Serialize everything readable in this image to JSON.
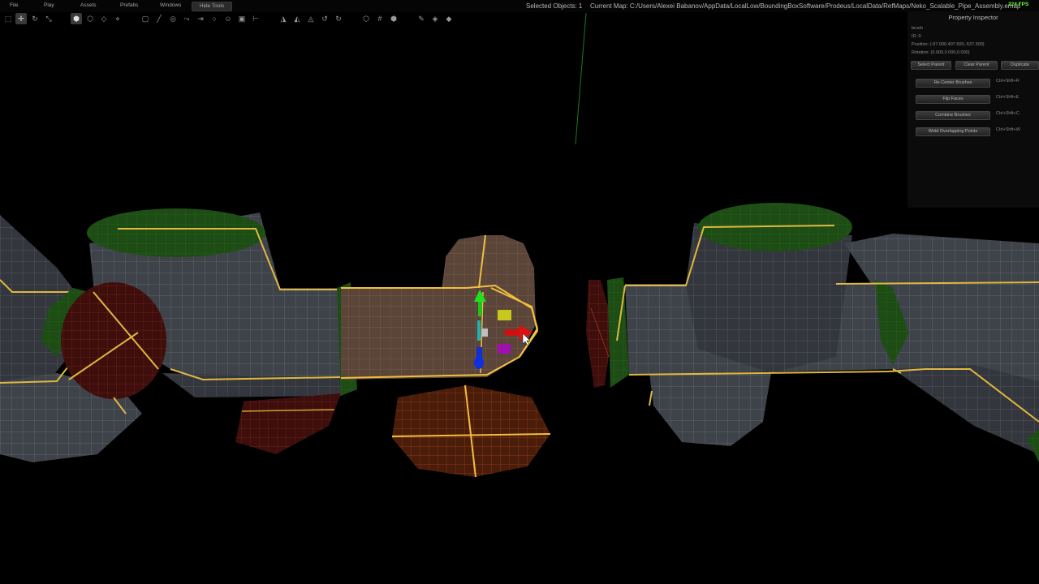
{
  "menu": {
    "file": "File",
    "play": "Play",
    "assets": "Assets",
    "prefabs": "Prefabs",
    "windows": "Windows",
    "hide_tools": "Hide Tools"
  },
  "status": {
    "selected_objects": "Selected Objects: 1",
    "current_map": "Current Map: C:/Users/Alexei Babanov/AppData/LocalLow/BoundingBoxSoftware/Prodeus/LocalData/RefMaps/Neko_Scalable_Pipe_Assembly.emap",
    "fps": "224 FPS"
  },
  "toolbar": {
    "icons": [
      "select-icon",
      "move-icon",
      "rotate-icon",
      "scale-icon",
      "solid-view-icon",
      "shaded-view-icon",
      "wireframe-icon",
      "vertex-view-icon",
      "box-tool-icon",
      "line-tool-icon",
      "cylinder-tool-icon",
      "path-tool-icon",
      "clip-tool-icon",
      "sphere-tool-icon",
      "face-tool-icon",
      "texture-tool-icon",
      "measure-icon",
      "mirror-x-icon",
      "mirror-y-icon",
      "mirror-z-icon",
      "rotate-left-icon",
      "rotate-right-icon",
      "cube-icon",
      "grid-icon",
      "snap-icon",
      "eyedropper-icon",
      "paint-bucket-icon",
      "fill-icon"
    ]
  },
  "inspector": {
    "title": "Property Inspector",
    "name": "brush",
    "id": "ID: 0",
    "position": "Position: (-97.000,407.500,-537.500)",
    "rotation": "Rotation: (0.000,0.000,0.000)",
    "select_parent": "Select Parent",
    "clear_parent": "Clear Parent",
    "duplicate": "Duplicate",
    "actions": [
      {
        "label": "Re-Center Brushes",
        "shortcut": "Ctrl+Shft+R"
      },
      {
        "label": "Flip Faces",
        "shortcut": "Ctrl+Shft+E"
      },
      {
        "label": "Combine Brushes",
        "shortcut": "Ctrl+Shft+C"
      },
      {
        "label": "Weld Overlapping Points",
        "shortcut": "Ctrl+Shft+W"
      }
    ]
  },
  "colors": {
    "background": "#000000",
    "mesh_gray": "#3e4249",
    "mesh_green": "#1d4d14",
    "selected_brown": "#5a4538",
    "edge_yellow": "#f0c040",
    "red_face": "#4a1010",
    "gizmo_red": "#e01010",
    "gizmo_green": "#20d020",
    "gizmo_blue": "#1030e0"
  }
}
